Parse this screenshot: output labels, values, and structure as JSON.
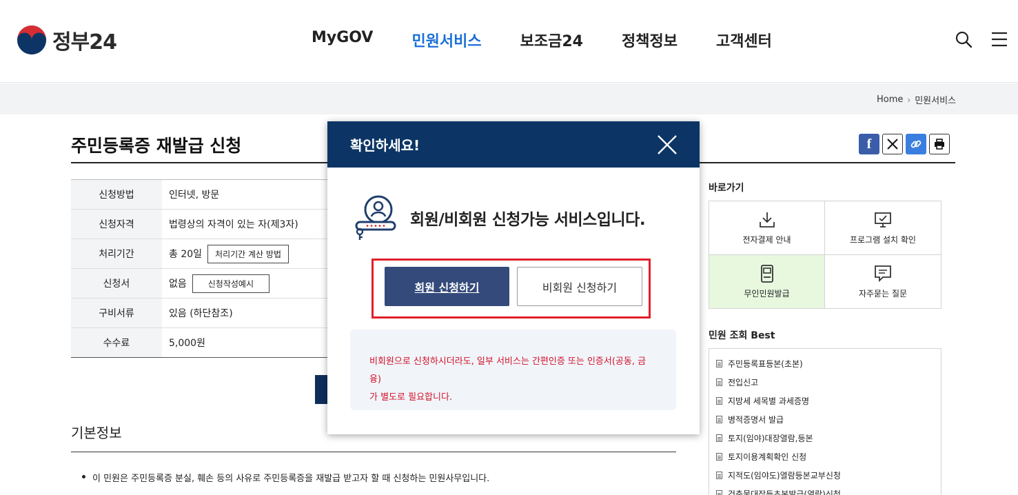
{
  "header": {
    "logo_text": "정부24",
    "nav": [
      {
        "label": "MyGOV",
        "active": false
      },
      {
        "label": "민원서비스",
        "active": true
      },
      {
        "label": "보조금24",
        "active": false
      },
      {
        "label": "정책정보",
        "active": false
      },
      {
        "label": "고객센터",
        "active": false
      }
    ],
    "icons": [
      "search-icon",
      "menu-icon"
    ]
  },
  "breadcrumb": {
    "home": "Home",
    "current": "민원서비스"
  },
  "page": {
    "title": "주민등록증 재발급 신청",
    "share_icons": [
      "facebook-icon",
      "x-icon",
      "link-icon",
      "print-icon"
    ]
  },
  "info": {
    "rows": [
      {
        "label": "신청방법",
        "value": "인터넷, 방문"
      },
      {
        "label": "신청자격",
        "value": "법령상의 자격이 있는 자(제3자)"
      },
      {
        "label": "처리기간",
        "value": "총 20일",
        "button": "처리기간 계산 방법"
      },
      {
        "label": "신청서",
        "value": "없음",
        "button": "신청작성예시"
      },
      {
        "label": "구비서류",
        "value": "있음 (하단참조)"
      },
      {
        "label": "수수료",
        "value": "5,000원"
      }
    ]
  },
  "basic_info": {
    "title": "기본정보",
    "bullet": "이 민원은 주민등록증 분실, 훼손 등의 사유로 주민등록증을 재발급 받고자 할 때 신청하는 민원사무입니다."
  },
  "sidebar": {
    "quick_title": "바로가기",
    "quick": [
      {
        "label": "전자결제 안내",
        "icon": "download-icon",
        "highlight": false
      },
      {
        "label": "프로그램 설치 확인",
        "icon": "monitor-check-icon",
        "highlight": false
      },
      {
        "label": "무인민원발급",
        "icon": "kiosk-icon",
        "highlight": true
      },
      {
        "label": "자주묻는 질문",
        "icon": "chat-icon",
        "highlight": false
      }
    ],
    "best_title": "민원 조회 Best",
    "best": [
      "주민등록표등본(초본)",
      "전입신고",
      "지방세 세목별 과세증명",
      "병적증명서 발급",
      "토지(임야)대장열람,등본",
      "토지이용계획확인 신청",
      "지적도(임야도)열람등본교부신청",
      "건축물대장등초본발급(열람)신청"
    ]
  },
  "modal": {
    "title": "확인하세요!",
    "message": "회원/비회원 신청가능 서비스입니다.",
    "member_button": "회원 신청하기",
    "guest_button": "비회원 신청하기",
    "notice_line1": "비회원으로 신청하시더라도, 일부 서비스는 간편인증 또는 인증서(공동, 금융)",
    "notice_line2": "가 별도로 필요합니다."
  },
  "colors": {
    "brand_navy": "#0c3565",
    "active_nav": "#1a6fd6",
    "member_button": "#344a7a",
    "highlight_frame": "#e01f2a",
    "notice_text": "#d1122a",
    "quick_highlight": "#e7f8df"
  }
}
